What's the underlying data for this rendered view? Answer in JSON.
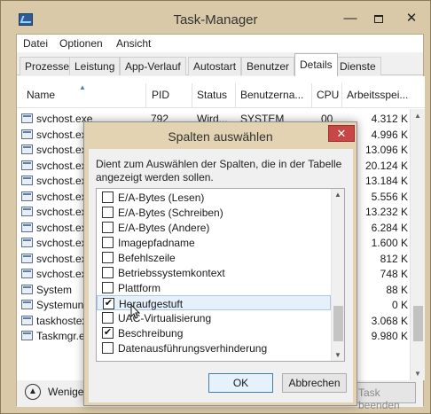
{
  "window": {
    "title": "Task-Manager",
    "minimize": "—",
    "close": "✕"
  },
  "menu": [
    "Datei",
    "Optionen",
    "Ansicht"
  ],
  "tabs": [
    "Prozesse",
    "Leistung",
    "App-Verlauf",
    "Autostart",
    "Benutzer",
    "Details",
    "Dienste"
  ],
  "active_tab": "Details",
  "columns": {
    "name": "Name",
    "pid": "PID",
    "status": "Status",
    "user": "Benutzerna...",
    "cpu": "CPU",
    "mem": "Arbeitsspei..."
  },
  "rows": [
    {
      "name": "svchost.exe",
      "pid": "792",
      "status": "Wird...",
      "user": "SYSTEM",
      "cpu": "00",
      "mem": "4.312 K"
    },
    {
      "name": "svchost.exe",
      "mem": "4.996 K"
    },
    {
      "name": "svchost.exe",
      "mem": "13.096 K"
    },
    {
      "name": "svchost.exe",
      "mem": "20.124 K"
    },
    {
      "name": "svchost.exe",
      "mem": "13.184 K"
    },
    {
      "name": "svchost.exe",
      "mem": "5.556 K"
    },
    {
      "name": "svchost.exe",
      "mem": "13.232 K"
    },
    {
      "name": "svchost.exe",
      "mem": "6.284 K"
    },
    {
      "name": "svchost.exe",
      "mem": "1.600 K"
    },
    {
      "name": "svchost.exe",
      "mem": "812 K"
    },
    {
      "name": "svchost.exe",
      "mem": "748 K"
    },
    {
      "name": "System",
      "mem": "88 K"
    },
    {
      "name": "Systemunterbrechungen",
      "mem": "0 K"
    },
    {
      "name": "taskhostex.exe",
      "mem": "3.068 K"
    },
    {
      "name": "Taskmgr.exe",
      "mem": "9.980 K"
    }
  ],
  "footer": {
    "less_label": "Weniger Details",
    "end_label": "Task beenden"
  },
  "dialog": {
    "title": "Spalten auswählen",
    "close": "✕",
    "description": "Dient zum Auswählen der Spalten, die in der Tabelle angezeigt werden sollen.",
    "items": [
      {
        "label": "E/A-Bytes (Lesen)",
        "checked": false
      },
      {
        "label": "E/A-Bytes (Schreiben)",
        "checked": false
      },
      {
        "label": "E/A-Bytes (Andere)",
        "checked": false
      },
      {
        "label": "Imagepfadname",
        "checked": false
      },
      {
        "label": "Befehlszeile",
        "checked": false
      },
      {
        "label": "Betriebssystemkontext",
        "checked": false
      },
      {
        "label": "Plattform",
        "checked": false
      },
      {
        "label": "Heraufgestuft",
        "checked": true,
        "selected": true
      },
      {
        "label": "UAC-Virtualisierung",
        "checked": false
      },
      {
        "label": "Beschreibung",
        "checked": true
      },
      {
        "label": "Datenausführungsverhinderung",
        "checked": false
      }
    ],
    "ok": "OK",
    "cancel": "Abbrechen"
  }
}
